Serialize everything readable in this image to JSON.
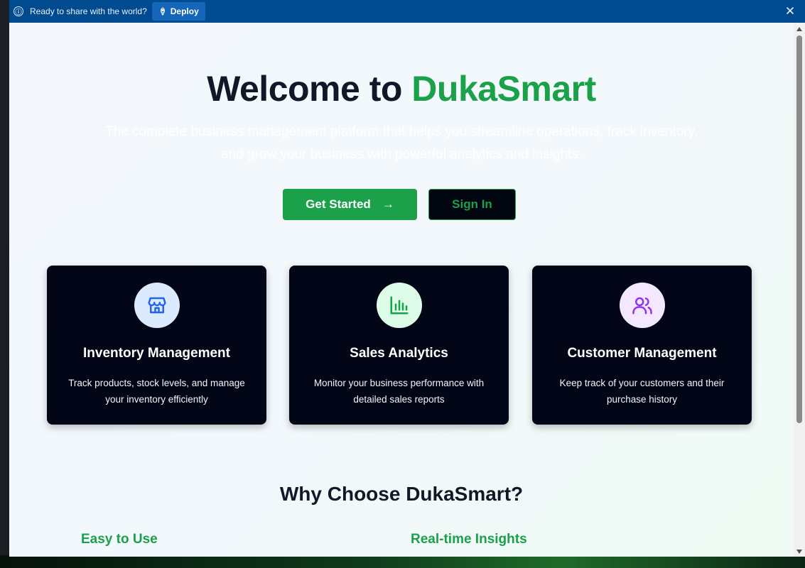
{
  "banner": {
    "message": "Ready to share with the world?",
    "deploy_label": "Deploy",
    "info_icon": "ⓘ",
    "colors": {
      "background": "#004b8f",
      "button": "#1565b8"
    }
  },
  "hero": {
    "title_prefix": "Welcome to ",
    "title_brand": "DukaSmart",
    "subtitle_line1": "The complete business management platform that helps you streamline operations, track inventory,",
    "subtitle_line2": "and grow your business with powerful analytics and insights.",
    "get_started_label": "Get Started",
    "get_started_arrow": "→",
    "sign_in_label": "Sign In"
  },
  "cards": [
    {
      "title": "Inventory Management",
      "description": "Track products, stock levels, and manage your inventory efficiently",
      "icon": "store-icon",
      "icon_bg": "#dbeafe",
      "icon_color": "#2563eb"
    },
    {
      "title": "Sales Analytics",
      "description": "Monitor your business performance with detailed sales reports",
      "icon": "bar-chart-icon",
      "icon_bg": "#dcfce7",
      "icon_color": "#16a34a"
    },
    {
      "title": "Customer Management",
      "description": "Keep track of your customers and their purchase history",
      "icon": "users-icon",
      "icon_bg": "#f3e8ff",
      "icon_color": "#9333ea"
    }
  ],
  "why": {
    "title": "Why Choose DukaSmart?",
    "features": [
      "Easy to Use",
      "Real-time Insights"
    ]
  },
  "colors": {
    "brand_green": "#1aa14a",
    "card_bg": "#020617",
    "heading": "#111827"
  }
}
